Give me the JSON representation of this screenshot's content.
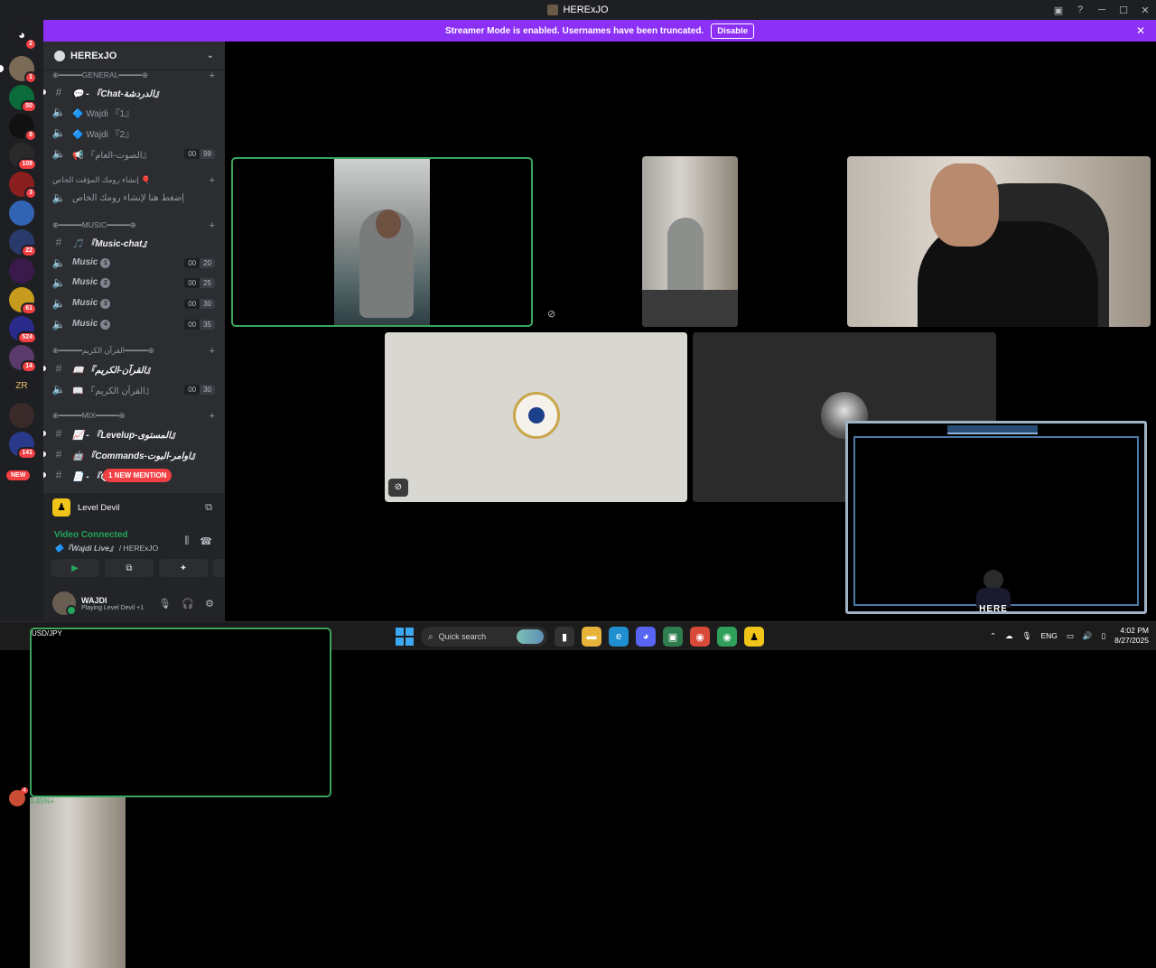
{
  "window": {
    "title": "HERExJO",
    "controls": {
      "minimize": "─",
      "maximize": "☐",
      "close": "✕"
    }
  },
  "banner": {
    "text": "Streamer Mode is enabled. Usernames have been truncated.",
    "button": "Disable",
    "color": "#8c30f5"
  },
  "guilds": {
    "home_badge": "2",
    "badges": [
      "1",
      "50",
      "8",
      "108",
      "3",
      "22",
      "61",
      "524",
      "14",
      "141"
    ],
    "new_label": "NEW"
  },
  "server": {
    "name": "HERExJO"
  },
  "categories": {
    "general": "⊕━━━━━GENERAL━━━━━⊕",
    "temp": "إنشاء رومك المؤقت الخاص 🎈",
    "music": "⊕━━━━━MUSIC━━━━━⊕",
    "quran": "⊕━━━━━القرآن الكريم━━━━━⊕",
    "mix": "⊕━━━━━MIX━━━━━⊕"
  },
  "channels": [
    {
      "label": "💬 - 『Chat-الدردشة』",
      "type": "text",
      "style": "bold"
    },
    {
      "label": "🔷 Wajdi 『1』",
      "type": "voice"
    },
    {
      "label": "🔷 Wajdi 『2』",
      "type": "voice"
    },
    {
      "label": "📢 『الصوت-العام』",
      "type": "voice",
      "c1": "00",
      "c2": "99"
    },
    {
      "label": "إضغط هنا لإنشاء رومك الخاص",
      "type": "voice"
    },
    {
      "label": "🎵 『Music-chat』",
      "type": "text",
      "style": "bold"
    },
    {
      "label": "Music",
      "num": "1",
      "type": "voice",
      "style": "music",
      "c1": "00",
      "c2": "20"
    },
    {
      "label": "Music",
      "num": "2",
      "type": "voice",
      "style": "music",
      "c1": "00",
      "c2": "25"
    },
    {
      "label": "Music",
      "num": "3",
      "type": "voice",
      "style": "music",
      "c1": "00",
      "c2": "30"
    },
    {
      "label": "Music",
      "num": "4",
      "type": "voice",
      "style": "music",
      "c1": "00",
      "c2": "35"
    },
    {
      "label": "📖 『القرآن-الكريم』",
      "type": "text",
      "style": "bold"
    },
    {
      "label": "📖 『القرآن الكريم』",
      "type": "voice",
      "c1": "00",
      "c2": "30"
    },
    {
      "label": "📈 - 『Levelup-المستوى』",
      "type": "text",
      "style": "bold"
    },
    {
      "label": "🤖 『Commands-اوامر-البوت』",
      "type": "text",
      "style": "bold"
    },
    {
      "label": "📄 - 『Q",
      "type": "text",
      "style": "bold"
    }
  ],
  "mention_pill": "1 NEW MENTION",
  "activity": {
    "game": "Level Devil"
  },
  "voice": {
    "status": "Video Connected",
    "channel": "🔷『Wajdi Live』",
    "server": " / HERExJO"
  },
  "user": {
    "name": "WAJDI",
    "status": "Playing Level Devil",
    "extra": " +1"
  },
  "stream": {
    "overlay_text": "HERE"
  },
  "taskbar": {
    "ticker": {
      "symbol": "USD/JPY",
      "change": "0.45%+",
      "badge": "4"
    },
    "search_placeholder": "Quick search",
    "lang": "ENG",
    "time": "4:02 PM",
    "date": "8/27/2025"
  },
  "colors": {
    "accent": "#5865f2",
    "online": "#23a55a",
    "danger": "#f23f43",
    "brand_purple": "#8c30f5"
  }
}
